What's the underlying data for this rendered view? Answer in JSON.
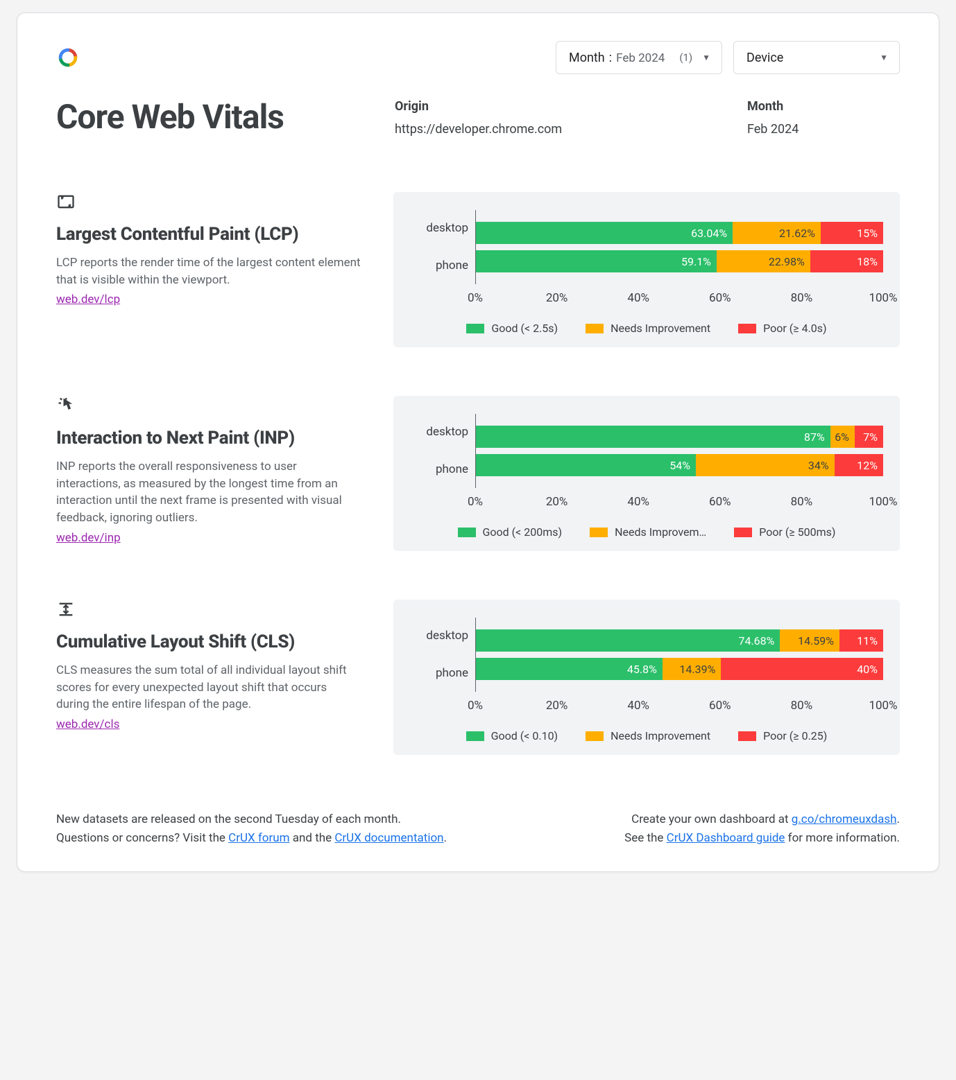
{
  "colors": {
    "good": "#2bbf6a",
    "ni": "#ffae00",
    "poor": "#fc3c3c"
  },
  "selectors": {
    "month": {
      "label": "Month",
      "value": "Feb 2024",
      "count": "(1)"
    },
    "device": {
      "label": "Device"
    }
  },
  "page_title": "Core Web Vitals",
  "header": {
    "origin": {
      "label": "Origin",
      "value": "https://developer.chrome.com"
    },
    "month": {
      "label": "Month",
      "value": "Feb 2024"
    }
  },
  "vitals": [
    {
      "id": "lcp",
      "title": "Largest Contentful Paint (LCP)",
      "desc": "LCP reports the render time of the largest content element that is visible within the viewport.",
      "link": "web.dev/lcp",
      "legend": {
        "good": "Good (< 2.5s)",
        "ni": "Needs Improvement",
        "poor": "Poor (≥ 4.0s)"
      },
      "rows": [
        {
          "label": "desktop",
          "good": {
            "v": 63.04,
            "t": "63.04%"
          },
          "ni": {
            "v": 21.62,
            "t": "21.62%"
          },
          "poor": {
            "v": 15.34,
            "t": "15%"
          }
        },
        {
          "label": "phone",
          "good": {
            "v": 59.1,
            "t": "59.1%"
          },
          "ni": {
            "v": 22.98,
            "t": "22.98%"
          },
          "poor": {
            "v": 17.92,
            "t": "18%"
          }
        }
      ]
    },
    {
      "id": "inp",
      "title": "Interaction to Next Paint (INP)",
      "desc": "INP reports the overall responsiveness to user interactions, as measured by the longest time from an interaction until the next frame is presented with visual feedback, ignoring outliers.",
      "link": "web.dev/inp",
      "legend": {
        "good": "Good (< 200ms)",
        "ni": "Needs Improvem…",
        "poor": "Poor (≥ 500ms)"
      },
      "rows": [
        {
          "label": "desktop",
          "good": {
            "v": 87,
            "t": "87%"
          },
          "ni": {
            "v": 6,
            "t": "6%"
          },
          "poor": {
            "v": 7,
            "t": "7%"
          }
        },
        {
          "label": "phone",
          "good": {
            "v": 54,
            "t": "54%"
          },
          "ni": {
            "v": 34,
            "t": "34%"
          },
          "poor": {
            "v": 12,
            "t": "12%"
          }
        }
      ]
    },
    {
      "id": "cls",
      "title": "Cumulative Layout Shift (CLS)",
      "desc": "CLS measures the sum total of all individual layout shift scores for every unexpected layout shift that occurs during the entire lifespan of the page.",
      "link": "web.dev/cls",
      "legend": {
        "good": "Good (< 0.10)",
        "ni": "Needs Improvement",
        "poor": "Poor (≥ 0.25)"
      },
      "rows": [
        {
          "label": "desktop",
          "good": {
            "v": 74.68,
            "t": "74.68%"
          },
          "ni": {
            "v": 14.59,
            "t": "14.59%"
          },
          "poor": {
            "v": 10.73,
            "t": "11%"
          }
        },
        {
          "label": "phone",
          "good": {
            "v": 45.8,
            "t": "45.8%"
          },
          "ni": {
            "v": 14.39,
            "t": "14.39%"
          },
          "poor": {
            "v": 39.81,
            "t": "40%"
          }
        }
      ]
    }
  ],
  "xaxis": [
    "0%",
    "20%",
    "40%",
    "60%",
    "80%",
    "100%"
  ],
  "footer": {
    "left_line1": "New datasets are released on the second Tuesday of each month.",
    "left_line2_a": "Questions or concerns? Visit the ",
    "left_link1": "CrUX forum",
    "left_line2_b": " and the ",
    "left_link2": "CrUX documentation",
    "left_line2_c": ".",
    "right_line1_a": "Create your own dashboard at ",
    "right_link1": "g.co/chromeuxdash",
    "right_line1_b": ".",
    "right_line2_a": "See the ",
    "right_link2": "CrUX Dashboard guide",
    "right_line2_b": " for more information."
  },
  "chart_data": [
    {
      "type": "bar",
      "title": "Largest Contentful Paint (LCP)",
      "categories": [
        "desktop",
        "phone"
      ],
      "series": [
        {
          "name": "Good (< 2.5s)",
          "values": [
            63.04,
            59.1
          ]
        },
        {
          "name": "Needs Improvement",
          "values": [
            21.62,
            22.98
          ]
        },
        {
          "name": "Poor (≥ 4.0s)",
          "values": [
            15.34,
            17.92
          ]
        }
      ],
      "xlabel": "",
      "ylabel": "",
      "xlim": [
        0,
        100
      ],
      "stacked": true,
      "orientation": "horizontal",
      "unit": "%"
    },
    {
      "type": "bar",
      "title": "Interaction to Next Paint (INP)",
      "categories": [
        "desktop",
        "phone"
      ],
      "series": [
        {
          "name": "Good (< 200ms)",
          "values": [
            87,
            54
          ]
        },
        {
          "name": "Needs Improvement",
          "values": [
            6,
            34
          ]
        },
        {
          "name": "Poor (≥ 500ms)",
          "values": [
            7,
            12
          ]
        }
      ],
      "xlabel": "",
      "ylabel": "",
      "xlim": [
        0,
        100
      ],
      "stacked": true,
      "orientation": "horizontal",
      "unit": "%"
    },
    {
      "type": "bar",
      "title": "Cumulative Layout Shift (CLS)",
      "categories": [
        "desktop",
        "phone"
      ],
      "series": [
        {
          "name": "Good (< 0.10)",
          "values": [
            74.68,
            45.8
          ]
        },
        {
          "name": "Needs Improvement",
          "values": [
            14.59,
            14.39
          ]
        },
        {
          "name": "Poor (≥ 0.25)",
          "values": [
            10.73,
            39.81
          ]
        }
      ],
      "xlabel": "",
      "ylabel": "",
      "xlim": [
        0,
        100
      ],
      "stacked": true,
      "orientation": "horizontal",
      "unit": "%"
    }
  ]
}
